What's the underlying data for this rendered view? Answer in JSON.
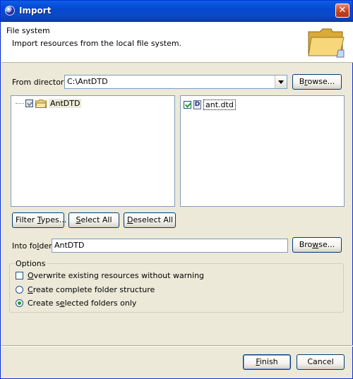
{
  "window": {
    "title": "Import"
  },
  "header": {
    "title": "File system",
    "description": "Import resources from the local file system."
  },
  "from_directory": {
    "label_pre": "From director",
    "label_mnemonic": "y",
    "label_post": ":",
    "value": "C:\\AntDTD",
    "browse_pre": "B",
    "browse_mnemonic": "r",
    "browse_post": "owse..."
  },
  "folder_tree": {
    "items": [
      {
        "label": "AntDTD",
        "checked": true,
        "grayed": true
      }
    ]
  },
  "file_list": {
    "items": [
      {
        "label": "ant.dtd",
        "checked": true,
        "icon_letter": "D"
      }
    ]
  },
  "selection_buttons": {
    "filter_pre": "Filter ",
    "filter_mnemonic": "T",
    "filter_post": "ypes...",
    "select_all_mnemonic": "S",
    "select_all_post": "elect All",
    "deselect_all_mnemonic": "D",
    "deselect_all_post": "eselect All"
  },
  "into_folder": {
    "label_pre": "Into fo",
    "label_mnemonic": "l",
    "label_post": "der:",
    "value": "AntDTD",
    "browse_pre": "Bro",
    "browse_mnemonic": "w",
    "browse_post": "se..."
  },
  "options": {
    "group_label": "Options",
    "overwrite_mnemonic": "O",
    "overwrite_post": "verwrite existing resources without warning",
    "overwrite_checked": false,
    "complete_mnemonic": "C",
    "complete_post": "reate complete folder structure",
    "complete_selected": false,
    "selected_pre": "Create s",
    "selected_mnemonic": "e",
    "selected_post": "lected folders only",
    "selected_selected": true
  },
  "footer": {
    "finish_mnemonic": "F",
    "finish_post": "inish",
    "cancel_label": "Cancel"
  },
  "colors": {
    "titlebar": "#0548d0",
    "window_bg": "#ece9d8",
    "accent_check": "#21a121"
  }
}
